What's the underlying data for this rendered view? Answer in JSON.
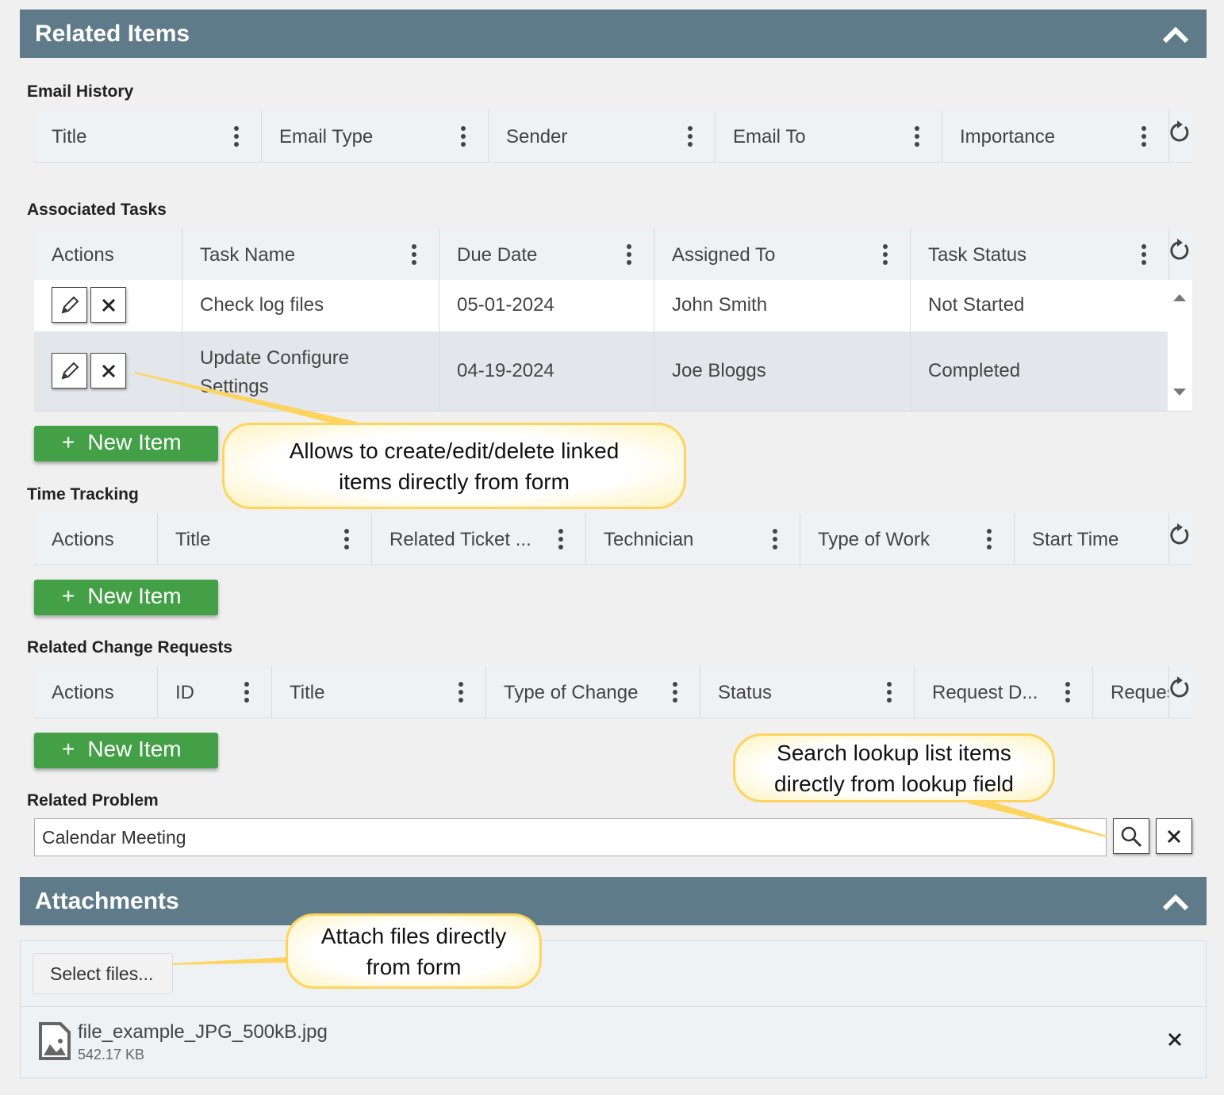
{
  "related_items": {
    "title": "Related Items",
    "email_history": {
      "label": "Email History",
      "columns": [
        "Title",
        "Email Type",
        "Sender",
        "Email To",
        "Importance"
      ]
    },
    "associated_tasks": {
      "label": "Associated Tasks",
      "columns": [
        "Actions",
        "Task Name",
        "Due Date",
        "Assigned To",
        "Task Status"
      ],
      "rows": [
        {
          "task_name": "Check log files",
          "due_date": "05-01-2024",
          "assigned_to": "John Smith",
          "status": "Not Started"
        },
        {
          "task_name": "Update Configure Settings",
          "due_date": "04-19-2024",
          "assigned_to": "Joe Bloggs",
          "status": "Completed"
        }
      ],
      "new_item": "New Item"
    },
    "time_tracking": {
      "label": "Time Tracking",
      "columns": [
        "Actions",
        "Title",
        "Related Ticket ...",
        "Technician",
        "Type of Work",
        "Start Time"
      ],
      "new_item": "New Item"
    },
    "change_requests": {
      "label": "Related Change Requests",
      "columns": [
        "Actions",
        "ID",
        "Title",
        "Type of Change",
        "Status",
        "Request D...",
        "Reques"
      ],
      "new_item": "New Item"
    },
    "related_problem": {
      "label": "Related Problem",
      "value": "Calendar Meeting"
    }
  },
  "attachments": {
    "title": "Attachments",
    "select_files": "Select files...",
    "files": [
      {
        "name": "file_example_JPG_500kB.jpg",
        "size": "542.17 KB"
      }
    ]
  },
  "callouts": {
    "edit": "Allows to create/edit/delete linked items directly from form",
    "lookup": "Search lookup list items directly from lookup field",
    "attach": "Attach files directly from form"
  },
  "colors": {
    "header": "#5f7b89",
    "new_button": "#43a047",
    "callout_border": "#fdd55e"
  }
}
